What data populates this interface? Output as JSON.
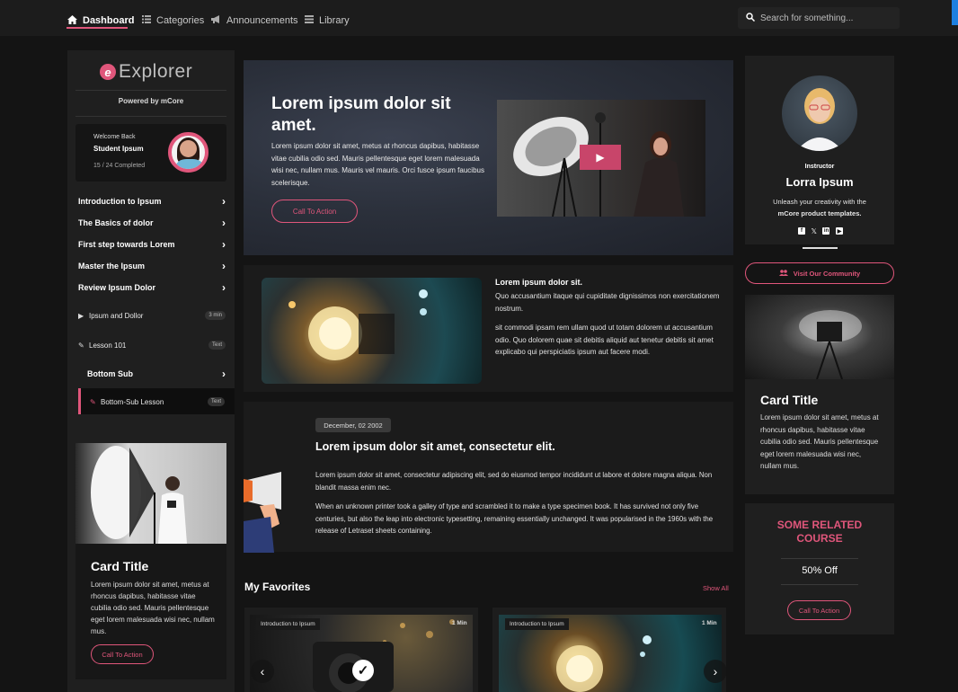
{
  "nav": {
    "dashboard": "Dashboard",
    "categories": "Categories",
    "announcements": "Announcements",
    "library": "Library",
    "search_placeholder": "Search for something..."
  },
  "sidebar": {
    "logo_letter": "e",
    "logo_text": "Explorer",
    "powered_by": "Powered by mCore",
    "welcome": "Welcome Back",
    "student_name": "Student Ipsum",
    "progress": "15 / 24 Completed",
    "sections": [
      {
        "label": "Introduction to Ipsum"
      },
      {
        "label": "The Basics of dolor"
      },
      {
        "label": "First step towards Lorem"
      },
      {
        "label": "Master the Ipsum"
      },
      {
        "label": "Review Ipsum Dolor"
      }
    ],
    "lessons": [
      {
        "label": "Ipsum and Dollor",
        "badge": "3 min",
        "icon": "play-icon"
      },
      {
        "label": "Lesson 101",
        "badge": "Text",
        "icon": "pencil-icon"
      }
    ],
    "bottom_sub": "Bottom Sub",
    "bottom_sub_lesson": {
      "label": "Bottom-Sub Lesson",
      "badge": "Text",
      "icon": "pencil-icon"
    },
    "card": {
      "title": "Card Title",
      "text": "Lorem ipsum dolor sit amet, metus at rhoncus dapibus, habitasse vitae cubilia odio sed. Mauris pellentesque eget lorem malesuada wisi nec, nullam mus.",
      "button": "Call To Action"
    }
  },
  "hero": {
    "title": "Lorem ipsum dolor sit amet.",
    "text": "Lorem ipsum dolor sit amet, metus at rhoncus dapibus, habitasse vitae cubilia odio sed. Mauris pellentesque eget lorem malesuada wisi nec, nullam mus. Mauris vel mauris. Orci fusce ipsum faucibus scelerisque.",
    "button": "Call To Action"
  },
  "block2": {
    "title": "Lorem ipsum dolor sit.",
    "p1": "Quo accusantium itaque qui cupiditate dignissimos non exercitationem nostrum.",
    "p2": "sit commodi ipsam rem ullam quod ut totam dolorem ut accusantium odio. Quo dolorem quae sit debitis aliquid aut tenetur debitis sit amet explicabo qui perspiciatis ipsum aut facere modi."
  },
  "block3": {
    "date": "December, 02 2002",
    "title": "Lorem ipsum dolor sit amet, consectetur elit.",
    "p1": "Lorem ipsum dolor sit amet, consectetur adipiscing elit, sed do eiusmod tempor incididunt ut labore et dolore magna aliqua. Non blandit massa enim nec.",
    "p2": "When an unknown printer took a galley of type and scrambled it to make a type specimen book. It has survived not only five centuries, but also the leap into electronic typesetting, remaining essentially unchanged. It was popularised in the 1960s with the release of Letraset sheets containing."
  },
  "favorites": {
    "title": "My Favorites",
    "show_all": "Show All",
    "items": [
      {
        "tag": "Introduction to Ipsum",
        "duration": "1 Min"
      },
      {
        "tag": "Introduction to Ipsum",
        "duration": "1 Min"
      }
    ]
  },
  "instructor": {
    "label": "Instructor",
    "name": "Lorra Ipsum",
    "desc1": "Unleash your creativity with the",
    "desc2": "mCore product templates.",
    "community": "Visit Our Community"
  },
  "right_card": {
    "title": "Card Title",
    "text": "Lorem ipsum dolor sit amet, metus at rhoncus dapibus, habitasse vitae cubilia odio sed. Mauris pellentesque eget lorem malesuada wisi nec, nullam mus."
  },
  "related": {
    "title": "SOME RELATED COURSE",
    "offer": "50% Off",
    "button": "Call To Action"
  },
  "colors": {
    "accent": "#e0567b",
    "background": "#141414",
    "panel": "#1b1b1b"
  }
}
